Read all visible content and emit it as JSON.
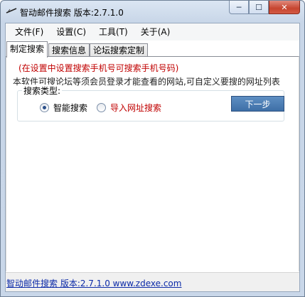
{
  "window": {
    "title": "智动邮件搜索 版本:2.7.1.0",
    "icon": "app-logo-icon",
    "buttons": {
      "minimize": "─",
      "maximize": "☐",
      "close": "✕"
    }
  },
  "menu": {
    "items": [
      {
        "label": "文件(F)"
      },
      {
        "label": "设置(C)"
      },
      {
        "label": "工具(T)"
      },
      {
        "label": "关于(A)"
      }
    ]
  },
  "tabs": [
    {
      "label": "制定搜索",
      "active": true
    },
    {
      "label": "搜索信息",
      "active": false
    },
    {
      "label": "论坛搜索定制",
      "active": false
    }
  ],
  "panel": {
    "note_red": "(在设置中设置搜索手机号可搜索手机号码)",
    "note_black": "本软件可搜论坛等须会员登录才能查看的网站,可自定义要搜的网址列表",
    "group_label": "搜索类型:",
    "options": [
      {
        "label": "智能搜索",
        "checked": true
      },
      {
        "label": "导入网址搜索",
        "checked": false
      }
    ],
    "next_button": "下一步"
  },
  "status": {
    "link_text": "智动邮件搜索 版本:2.7.1.0 www.zdexe.com"
  },
  "colors": {
    "accent_red": "#c00000",
    "button_blue": "#4a79b3",
    "link_blue": "#0b2aa8"
  }
}
